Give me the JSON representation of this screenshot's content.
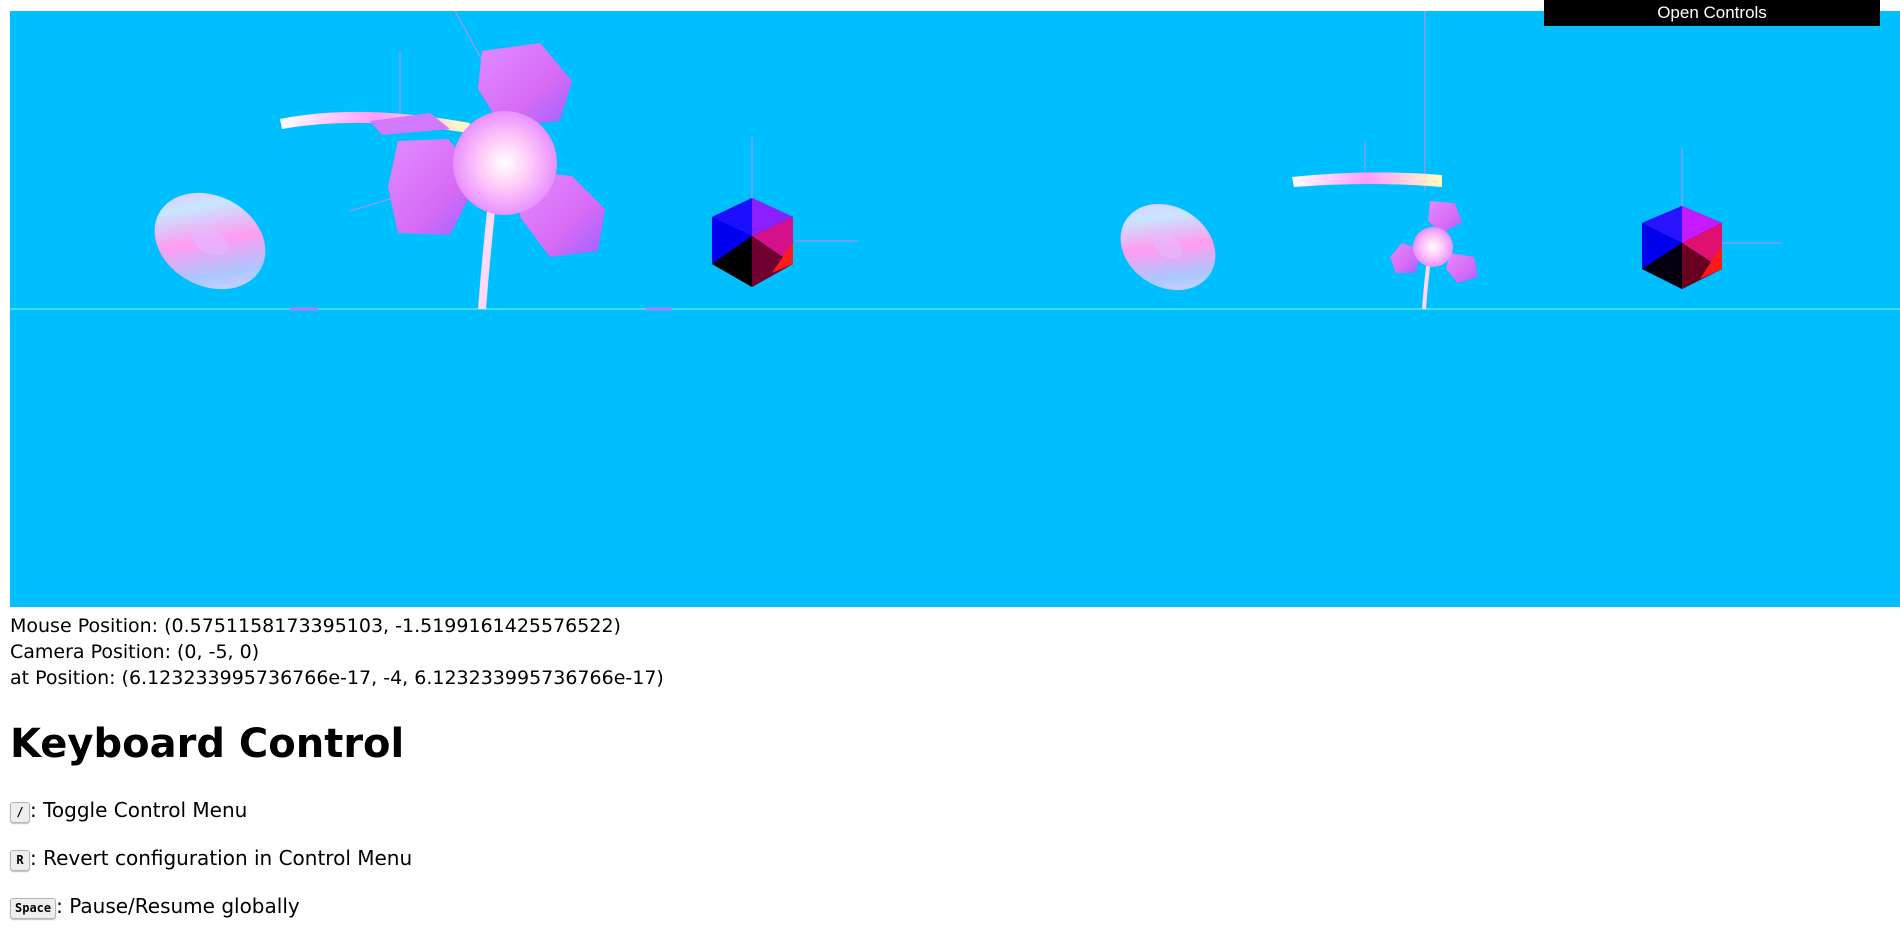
{
  "controls": {
    "open_label": "Open Controls"
  },
  "scene": {
    "background": "#00bfff",
    "objects": [
      "torus",
      "flower",
      "icosahedron",
      "torus",
      "flower",
      "icosahedron"
    ]
  },
  "info": {
    "mouse": "Mouse Position: (0.5751158173395103, -1.5199161425576522)",
    "camera": "Camera Position: (0, -5, 0)",
    "at": "at Position: (6.123233995736766e-17, -4, 6.123233995736766e-17)"
  },
  "keyboard": {
    "title": "Keyboard Control",
    "items": [
      {
        "key": "/",
        "desc": ": Toggle Control Menu"
      },
      {
        "key": "R",
        "desc": ": Revert configuration in Control Menu"
      },
      {
        "key": "Space",
        "desc": ": Pause/Resume globally"
      }
    ]
  }
}
